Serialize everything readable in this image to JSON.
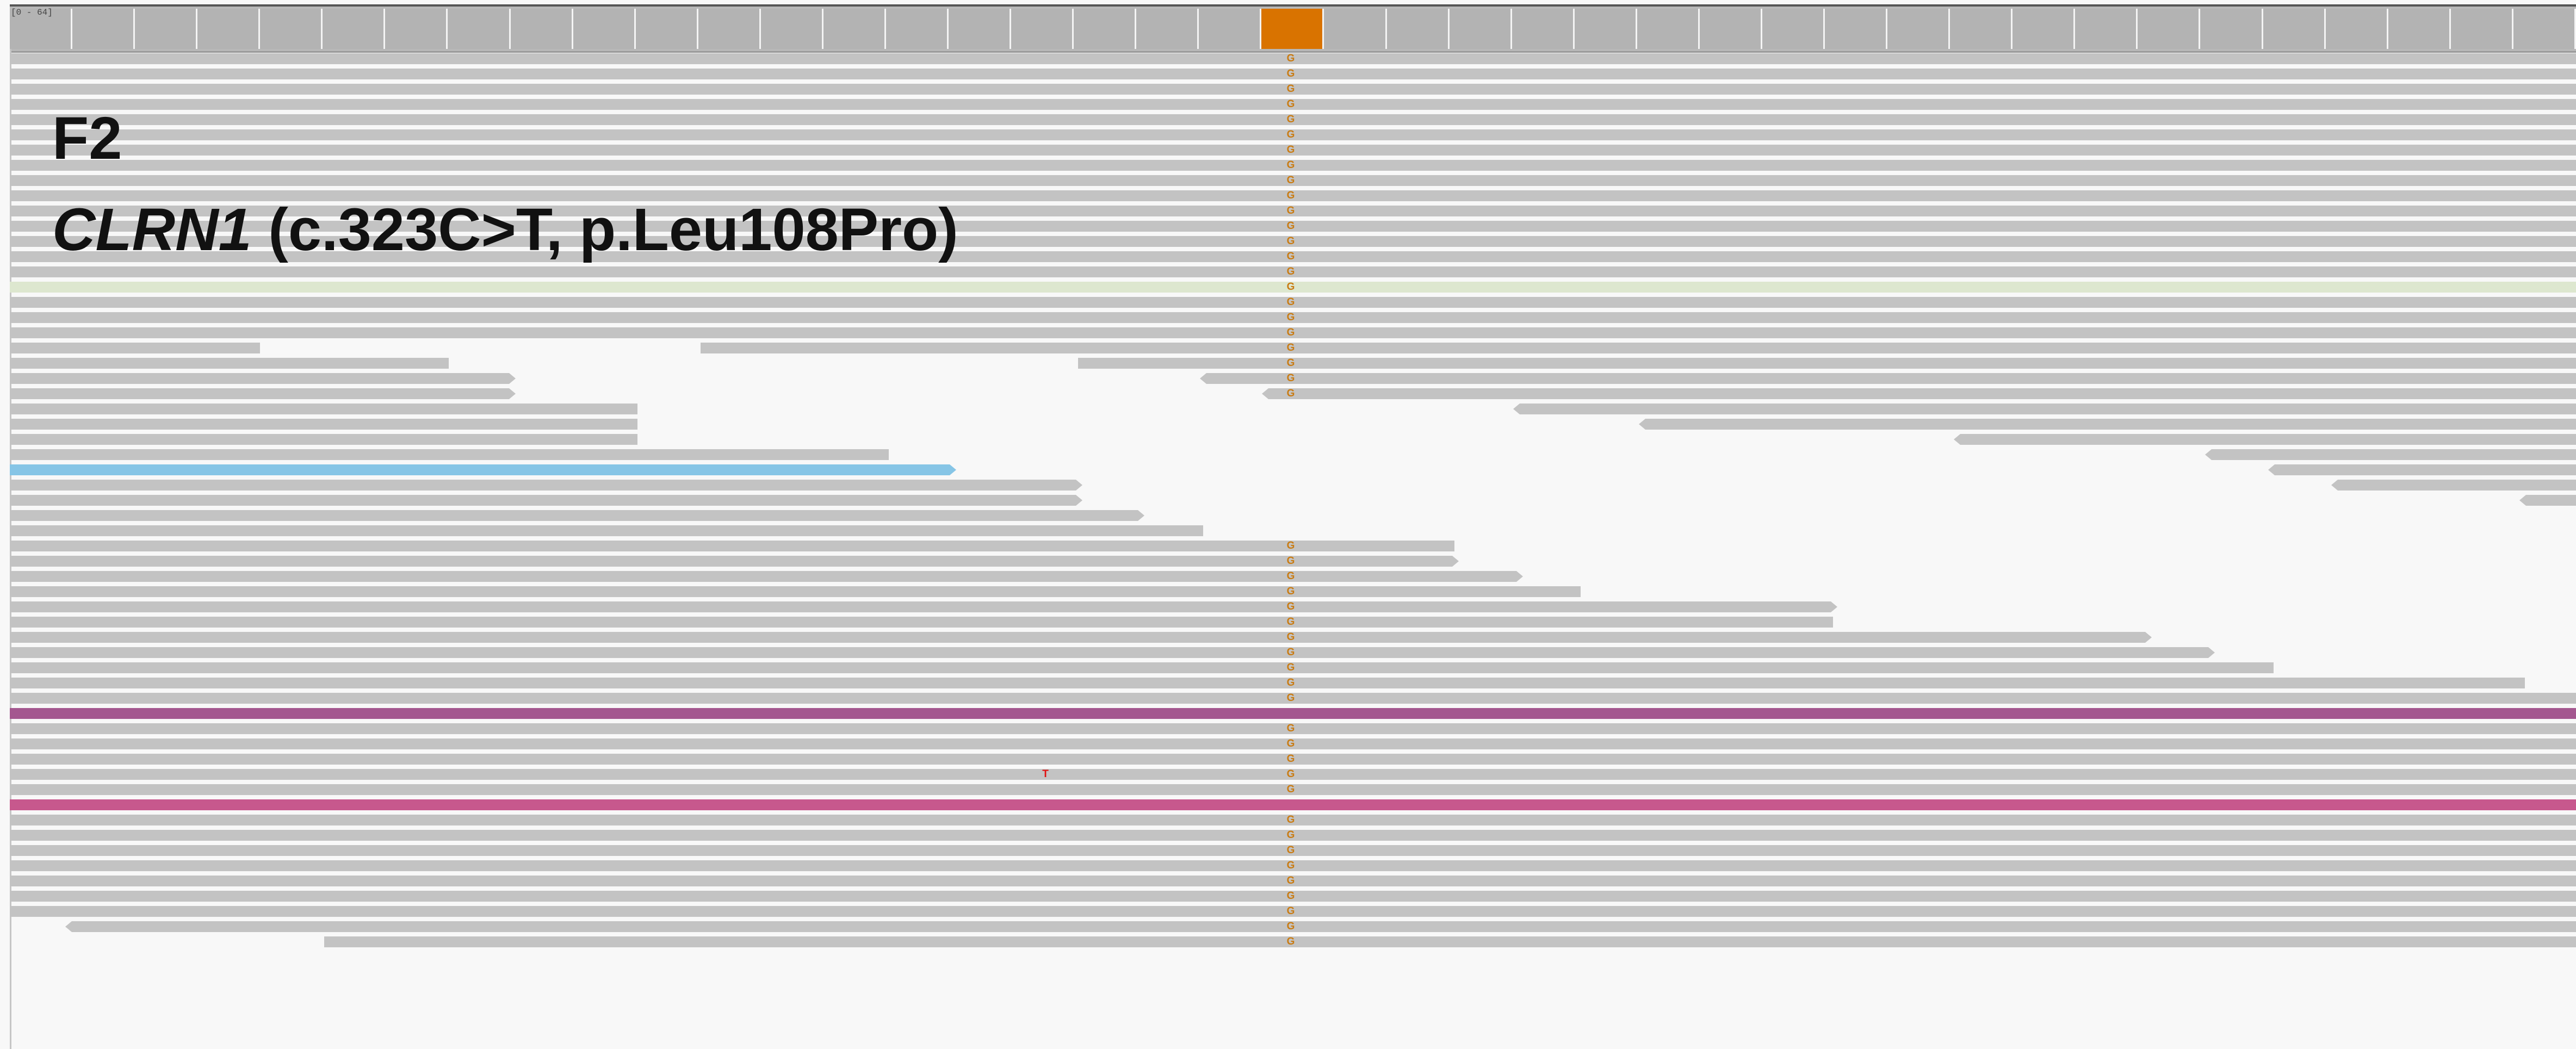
{
  "coverage": {
    "range_label": "[0 - 64]",
    "bin_count": 41,
    "variant_bin_index": 20,
    "colors": {
      "bin": "#b3b3b3",
      "variant_bin": "#d97300"
    }
  },
  "labels": {
    "sample": "F2",
    "gene": "CLRN1",
    "variant": "(c.323C>T, p.Leu108Pro)"
  },
  "alignment": {
    "variant_base": "G",
    "mismatch_base": "T",
    "colors": {
      "read": "#c3c3c3",
      "base_match_alt": "#c97b12",
      "mismatch": "#e01010",
      "highlight_green": "#dde7cf",
      "highlight_blue": "#86c5e6",
      "highlight_purple": "#a4578f",
      "highlight_pink": "#c7588d"
    }
  }
}
